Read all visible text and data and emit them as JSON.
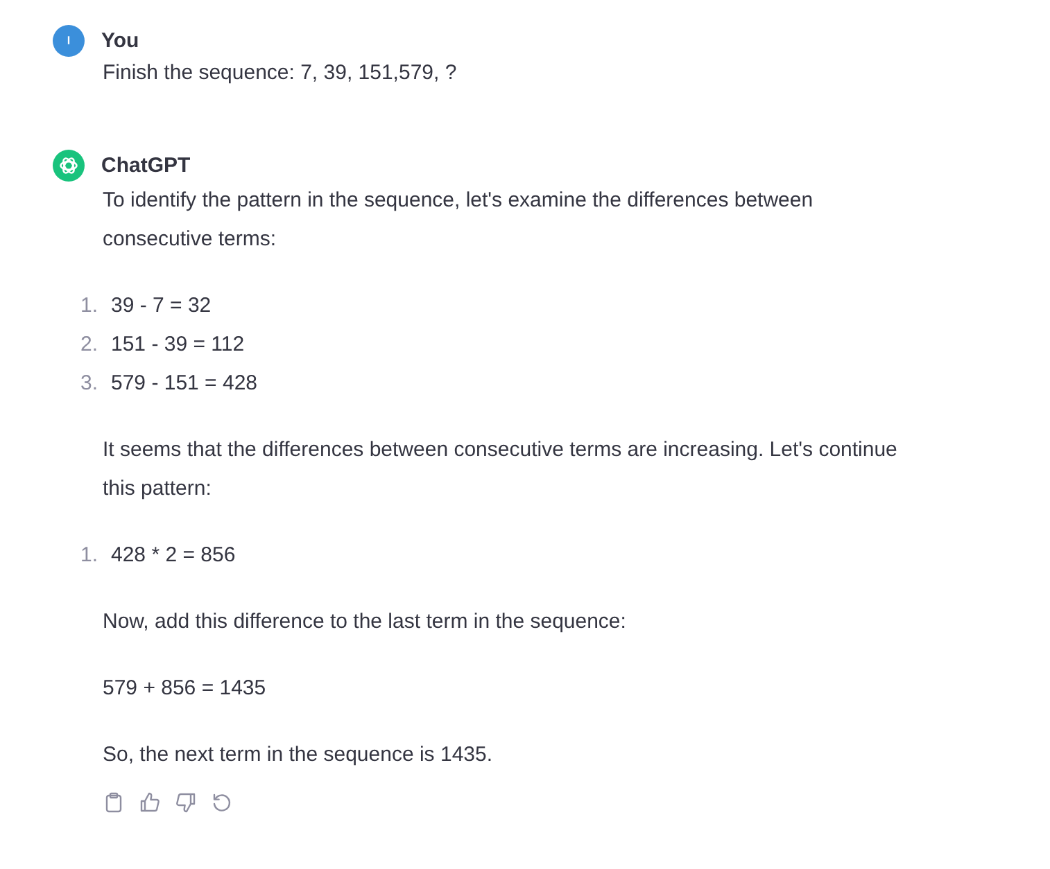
{
  "messages": [
    {
      "author": "You",
      "kind": "user",
      "blocks": [
        {
          "kind": "paragraph",
          "text": "Finish the sequence: 7, 39, 151,579, ?"
        }
      ]
    },
    {
      "author": "ChatGPT",
      "kind": "assistant",
      "blocks": [
        {
          "kind": "paragraph",
          "text": "To identify the pattern in the sequence, let's examine the differences between consecutive terms:"
        },
        {
          "kind": "list",
          "items": [
            {
              "number": "1.",
              "text": "39 - 7 = 32"
            },
            {
              "number": "2.",
              "text": "151 - 39 = 112"
            },
            {
              "number": "3.",
              "text": "579 - 151 = 428"
            }
          ]
        },
        {
          "kind": "paragraph",
          "text": "It seems that the differences between consecutive terms are increasing. Let's continue this pattern:"
        },
        {
          "kind": "list",
          "items": [
            {
              "number": "1.",
              "text": "428 * 2 = 856"
            }
          ]
        },
        {
          "kind": "paragraph",
          "text": "Now, add this difference to the last term in the sequence:"
        },
        {
          "kind": "paragraph",
          "text": "579 + 856 = 1435"
        },
        {
          "kind": "paragraph",
          "text": "So, the next term in the sequence is 1435."
        }
      ],
      "actions": true
    }
  ]
}
